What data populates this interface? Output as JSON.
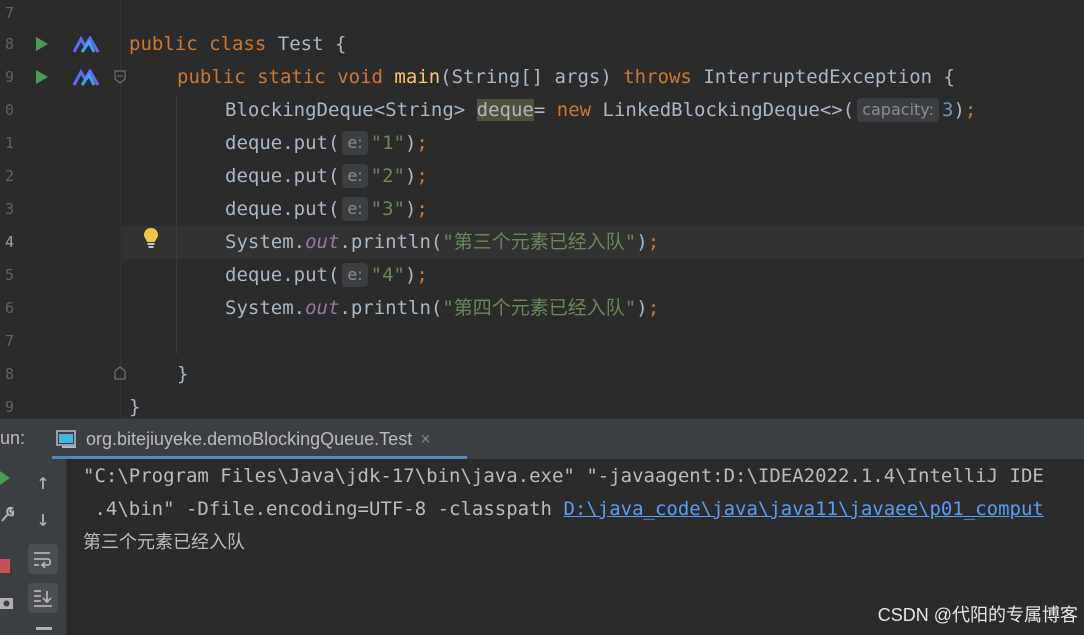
{
  "editor": {
    "line_numbers": [
      "7",
      "8",
      "9",
      "0",
      "1",
      "2",
      "3",
      "4",
      "5",
      "6",
      "7",
      "8",
      "9"
    ],
    "lines": {
      "l8": {
        "kw1": "public",
        "kw2": "class",
        "name": "Test",
        "brace": "{"
      },
      "l9": {
        "kw1": "public",
        "kw2": "static",
        "kw3": "void",
        "method": "main",
        "params": "(String[] args)",
        "throws": "throws",
        "exc": "InterruptedException",
        "brace": "{"
      },
      "l10": {
        "type": "BlockingDeque<String> ",
        "var": "deque",
        "eq": "= ",
        "new": "new",
        "ctor": " LinkedBlockingDeque<>(",
        "hint": "capacity:",
        "num": "3",
        "end": ")",
        "semi": ";"
      },
      "l11": {
        "call": "deque.put(",
        "hint": "e:",
        "str": "\"1\"",
        "end": ")",
        "semi": ";"
      },
      "l12": {
        "call": "deque.put(",
        "hint": "e:",
        "str": "\"2\"",
        "end": ")",
        "semi": ";"
      },
      "l13": {
        "call": "deque.put(",
        "hint": "e:",
        "str": "\"3\"",
        "end": ")",
        "semi": ";"
      },
      "l14": {
        "sys": "System.",
        "out": "out",
        "println": ".println(",
        "str": "\"第三个元素已经入队\"",
        "end": ")",
        "semi": ";"
      },
      "l15": {
        "call": "deque.put(",
        "hint": "e:",
        "str": "\"4\"",
        "end": ")",
        "semi": ";"
      },
      "l16": {
        "sys": "System.",
        "out": "out",
        "println": ".println(",
        "str": "\"第四个元素已经入队\"",
        "end": ")",
        "semi": ";"
      },
      "l18": {
        "brace": "}"
      },
      "l19": {
        "brace": "}"
      }
    }
  },
  "run_panel": {
    "label": "un:",
    "tab_title": "org.bitejiuyeke.demoBlockingQueue.Test",
    "tab_close": "×",
    "console": {
      "line1": "\"C:\\Program Files\\Java\\jdk-17\\bin\\java.exe\" \"-javaagent:D:\\IDEA2022.1.4\\IntelliJ IDE",
      "line2_prefix": " .4\\bin\" -Dfile.encoding=UTF-8 -classpath ",
      "line2_link": "D:\\java_code\\java\\java11\\javaee\\p01_comput",
      "line3": "第三个元素已经入队"
    },
    "tools": [
      "up-arrow-icon",
      "down-arrow-icon",
      "soft-wrap-icon",
      "scroll-to-end-icon"
    ]
  },
  "watermark": "CSDN @代阳的专属博客",
  "colors": {
    "background": "#2b2b2b",
    "keyword": "#cc7832",
    "string": "#6a8759",
    "number": "#6897bb",
    "method": "#ffc66d",
    "field": "#9876aa",
    "link": "#589df6",
    "run_green": "#499c54"
  }
}
